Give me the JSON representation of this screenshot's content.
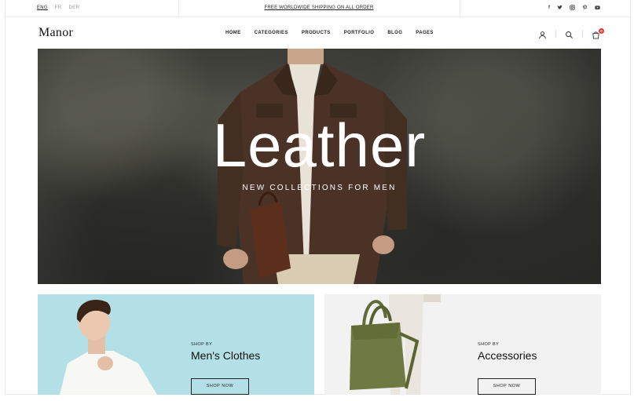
{
  "topbar": {
    "languages": [
      "ENG",
      "FR",
      "DER"
    ],
    "shipping_text": "FREE WORLDWIDE SHIPPING ON ALL ORDER",
    "social": [
      "f",
      "t",
      "ig",
      "p",
      "yt"
    ]
  },
  "header": {
    "logo": "Manor",
    "nav": [
      "HOME",
      "CATEGORIES",
      "PRODUCTS",
      "PORTFOLIO",
      "BLOG",
      "PAGES"
    ],
    "cart_count": "0",
    "icons": [
      "user-icon",
      "search-icon",
      "cart-icon"
    ]
  },
  "hero": {
    "title": "Leather",
    "subtitle": "NEW COLLECTIONS FOR MEN"
  },
  "cards": [
    {
      "eyebrow": "SHOP BY",
      "title": "Men's Clothes",
      "button": "SHOP NOW"
    },
    {
      "eyebrow": "SHOP BY",
      "title": "Accessories",
      "button": "SHOP NOW"
    }
  ],
  "colors": {
    "accent_badge": "#e53935",
    "card_left_bg": "#b3e0e6",
    "card_right_bg": "#f2f2f2"
  }
}
